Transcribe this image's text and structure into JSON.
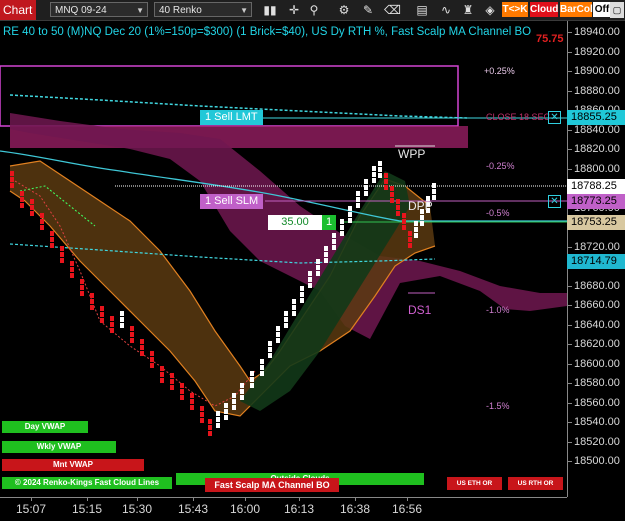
{
  "toolbar": {
    "chart_tab": "Chart",
    "instrument": "MNQ 09-24",
    "bar_type": "40 Renko",
    "buttons": {
      "tkx": "T<>K",
      "cloud": "Cloud",
      "barcol": "BarCol",
      "off": "Off"
    },
    "colors": {
      "chart_tab": "#c0181e",
      "tkx": "#ff7a00",
      "cloud": "#e0101a",
      "barcol": "#ff7a00",
      "off": "#ffffff"
    }
  },
  "chart": {
    "title": "RE 40 to 50 (M)NQ Dec 20 (1%=150p=$300) (1 Brick=$40), US Dy RTH %, Fast Scalp MA Channel BO",
    "overlay_price_red": "75.75",
    "annotations": {
      "wpp": "WPP",
      "dpp": "DPP",
      "ds1": "DS1",
      "pct_pos_025": "+0.25%",
      "pct_neg_025": "-0.25%",
      "pct_neg_05": "-0.5%",
      "pct_neg_10": "-1.0%",
      "pct_neg_15": "-1.5%",
      "close_label": "CLOSE 18 SEC"
    },
    "orders": {
      "sell_lmt": "1 Sell LMT",
      "sell_slm": "1 Sell SLM",
      "position_price": "35.00",
      "position_qty": "1"
    },
    "legend": {
      "day_vwap": "Day VWAP",
      "wkly_vwap": "Wkly VWAP",
      "mnt_vwap": "Mnt VWAP",
      "copyright": "© 2024 Renko-Kings Fast Cloud Lines",
      "outside_clouds": "Outside Clouds",
      "fast_scalp": "Fast Scalp MA Channel BO",
      "us_eth_or": "US ETH OR",
      "us_rth_or": "US RTH OR"
    }
  },
  "price_axis": {
    "ticks": [
      "18940.00",
      "18920.00",
      "18900.00",
      "18880.00",
      "18860.00",
      "18840.00",
      "18820.00",
      "18800.00",
      "18780.00",
      "18760.00",
      "18740.00",
      "18720.00",
      "18700.00",
      "18680.00",
      "18660.00",
      "18640.00",
      "18620.00",
      "18600.00",
      "18580.00",
      "18560.00",
      "18540.00",
      "18520.00",
      "18500.00"
    ],
    "tags": {
      "sell_lmt_price": "18855.25",
      "last_price": "18788.25",
      "sell_slm_price": "18773.25",
      "position_price_full": "18753.25",
      "cyan_line_price": "18714.79"
    }
  },
  "time_axis": {
    "ticks": [
      "15:07",
      "15:15",
      "15:30",
      "15:43",
      "16:00",
      "16:13",
      "16:38",
      "16:56"
    ]
  }
}
